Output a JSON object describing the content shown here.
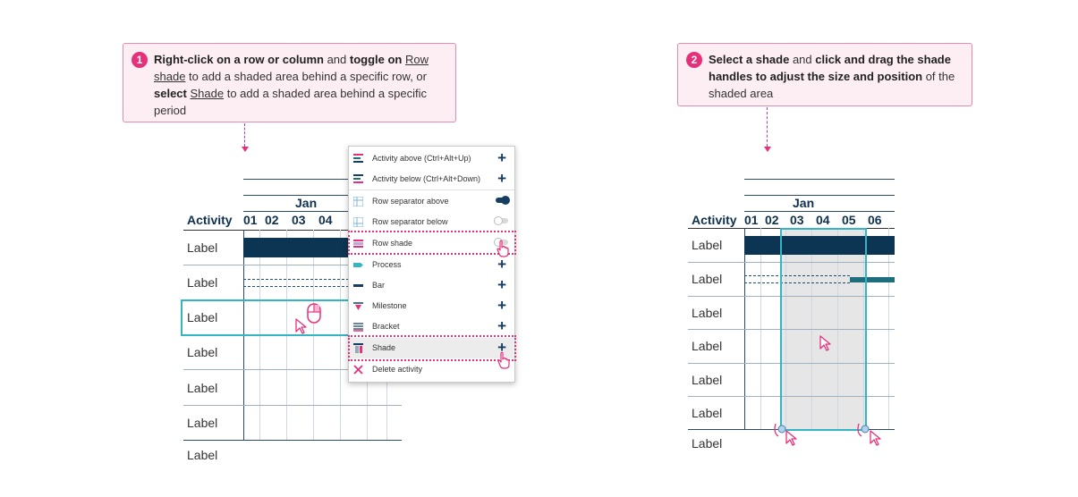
{
  "steps": [
    {
      "number": "1",
      "segments": [
        {
          "text": "Right-click on a row or column",
          "style": "b"
        },
        {
          "text": " and ",
          "style": ""
        },
        {
          "text": "toggle on",
          "style": "b"
        },
        {
          "text": " ",
          "style": ""
        },
        {
          "text": "Row shade",
          "style": "u"
        },
        {
          "text": " to add a shaded area behind a specific row, or ",
          "style": ""
        },
        {
          "text": "select",
          "style": "b"
        },
        {
          "text": " ",
          "style": ""
        },
        {
          "text": "Shade",
          "style": "u"
        },
        {
          "text": " to add a shaded area behind a specific period",
          "style": ""
        }
      ]
    },
    {
      "number": "2",
      "segments": [
        {
          "text": "Select a shade",
          "style": "b"
        },
        {
          "text": " and ",
          "style": ""
        },
        {
          "text": "click and drag the shade handles to adjust the size and position",
          "style": "b"
        },
        {
          "text": " of the shaded area",
          "style": ""
        }
      ]
    }
  ],
  "left_chart": {
    "month": "Jan",
    "activity_header": "Activity",
    "days": [
      "01",
      "02",
      "03",
      "04"
    ],
    "rows": [
      "Label",
      "Label",
      "Label",
      "Label",
      "Label",
      "Label",
      "Label"
    ]
  },
  "context_menu": {
    "items": [
      {
        "label": "Activity above (Ctrl+Alt+Up)",
        "icon": "activity-above-icon",
        "control": "plus"
      },
      {
        "label": "Activity below (Ctrl+Alt+Down)",
        "icon": "activity-below-icon",
        "control": "plus"
      },
      {
        "label": "Row separator above",
        "icon": "row-separator-above-icon",
        "control": "toggle-on"
      },
      {
        "label": "Row separator below",
        "icon": "row-separator-below-icon",
        "control": "toggle-off"
      },
      {
        "label": "Row shade",
        "icon": "row-shade-icon",
        "control": "toggle-off"
      },
      {
        "label": "Process",
        "icon": "process-icon",
        "control": "plus"
      },
      {
        "label": "Bar",
        "icon": "bar-icon",
        "control": "plus"
      },
      {
        "label": "Milestone",
        "icon": "milestone-icon",
        "control": "plus"
      },
      {
        "label": "Bracket",
        "icon": "bracket-icon",
        "control": "plus"
      },
      {
        "label": "Shade",
        "icon": "shade-icon",
        "control": "plus"
      },
      {
        "label": "Delete activity",
        "icon": "delete-icon",
        "control": "none"
      }
    ]
  },
  "right_chart": {
    "month": "Jan",
    "activity_header": "Activity",
    "days": [
      "01",
      "02",
      "03",
      "04",
      "05",
      "06"
    ],
    "rows": [
      "Label",
      "Label",
      "Label",
      "Label",
      "Label",
      "Label",
      "Label"
    ]
  },
  "colors": {
    "accent_pink": "#e6317a",
    "callout_bg": "#fdeef4",
    "bar_navy": "#0b3552",
    "bar_teal": "#1f6e7e",
    "selection_teal": "#35b4c4",
    "shade_grey": "#e6e6e6"
  }
}
